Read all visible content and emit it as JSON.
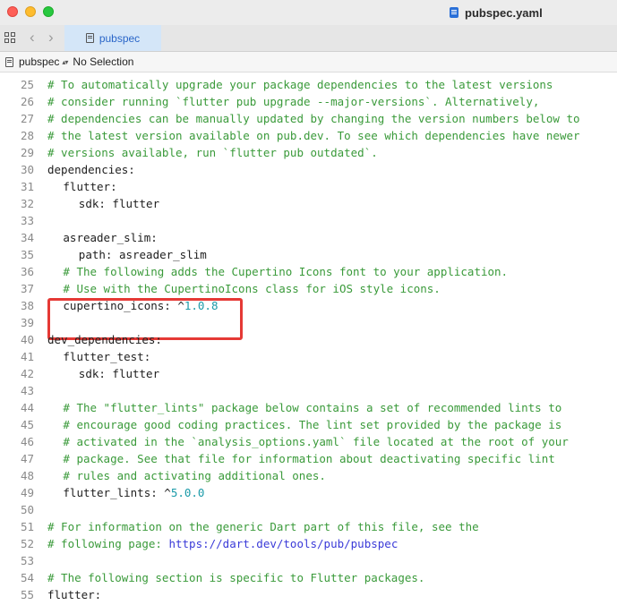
{
  "window": {
    "title": "pubspec.yaml"
  },
  "tab": {
    "label": "pubspec"
  },
  "jumpbar": {
    "file": "pubspec",
    "selection": "No Selection"
  },
  "highlight_color": "#e53935",
  "colors": {
    "comment": "#3a9a3a",
    "number": "#1a9aa8",
    "url": "#3a3ad8",
    "text": "#1e1e1e"
  },
  "lines": [
    {
      "n": "25",
      "indent": 0,
      "kind": "comment",
      "text": "# To automatically upgrade your package dependencies to the latest versions"
    },
    {
      "n": "26",
      "indent": 0,
      "kind": "comment",
      "text": "# consider running `flutter pub upgrade --major-versions`. Alternatively,"
    },
    {
      "n": "27",
      "indent": 0,
      "kind": "comment",
      "text": "# dependencies can be manually updated by changing the version numbers below to"
    },
    {
      "n": "28",
      "indent": 0,
      "kind": "comment",
      "text": "# the latest version available on pub.dev. To see which dependencies have newer"
    },
    {
      "n": "29",
      "indent": 0,
      "kind": "comment",
      "text": "# versions available, run `flutter pub outdated`."
    },
    {
      "n": "30",
      "indent": 0,
      "kind": "key",
      "text": "dependencies:"
    },
    {
      "n": "31",
      "indent": 2,
      "kind": "key",
      "text": "flutter:"
    },
    {
      "n": "32",
      "indent": 4,
      "kind": "key",
      "text": "sdk: flutter"
    },
    {
      "n": "33",
      "indent": 0,
      "kind": "blank",
      "text": ""
    },
    {
      "n": "34",
      "indent": 2,
      "kind": "key",
      "text": "asreader_slim:"
    },
    {
      "n": "35",
      "indent": 4,
      "kind": "key",
      "text": "path: asreader_slim"
    },
    {
      "n": "36",
      "indent": 2,
      "kind": "comment",
      "text": "# The following adds the Cupertino Icons font to your application."
    },
    {
      "n": "37",
      "indent": 2,
      "kind": "comment",
      "text": "# Use with the CupertinoIcons class for iOS style icons."
    },
    {
      "n": "38",
      "indent": 2,
      "kind": "version",
      "text": "cupertino_icons: ^",
      "value": "1.0.8"
    },
    {
      "n": "39",
      "indent": 0,
      "kind": "blank",
      "text": ""
    },
    {
      "n": "40",
      "indent": 0,
      "kind": "key",
      "text": "dev_dependencies:"
    },
    {
      "n": "41",
      "indent": 2,
      "kind": "key",
      "text": "flutter_test:"
    },
    {
      "n": "42",
      "indent": 4,
      "kind": "key",
      "text": "sdk: flutter"
    },
    {
      "n": "43",
      "indent": 0,
      "kind": "blank",
      "text": ""
    },
    {
      "n": "44",
      "indent": 2,
      "kind": "comment",
      "text": "# The \"flutter_lints\" package below contains a set of recommended lints to"
    },
    {
      "n": "45",
      "indent": 2,
      "kind": "comment",
      "text": "# encourage good coding practices. The lint set provided by the package is"
    },
    {
      "n": "46",
      "indent": 2,
      "kind": "comment",
      "text": "# activated in the `analysis_options.yaml` file located at the root of your"
    },
    {
      "n": "47",
      "indent": 2,
      "kind": "comment",
      "text": "# package. See that file for information about deactivating specific lint"
    },
    {
      "n": "48",
      "indent": 2,
      "kind": "comment",
      "text": "# rules and activating additional ones."
    },
    {
      "n": "49",
      "indent": 2,
      "kind": "version",
      "text": "flutter_lints: ^",
      "value": "5.0.0"
    },
    {
      "n": "50",
      "indent": 0,
      "kind": "blank",
      "text": ""
    },
    {
      "n": "51",
      "indent": 0,
      "kind": "comment",
      "text": "# For information on the generic Dart part of this file, see the"
    },
    {
      "n": "52",
      "indent": 0,
      "kind": "link",
      "text": "# following page: ",
      "value": "https://dart.dev/tools/pub/pubspec"
    },
    {
      "n": "53",
      "indent": 0,
      "kind": "blank",
      "text": ""
    },
    {
      "n": "54",
      "indent": 0,
      "kind": "comment",
      "text": "# The following section is specific to Flutter packages."
    },
    {
      "n": "55",
      "indent": 0,
      "kind": "key",
      "text": "flutter:"
    }
  ]
}
